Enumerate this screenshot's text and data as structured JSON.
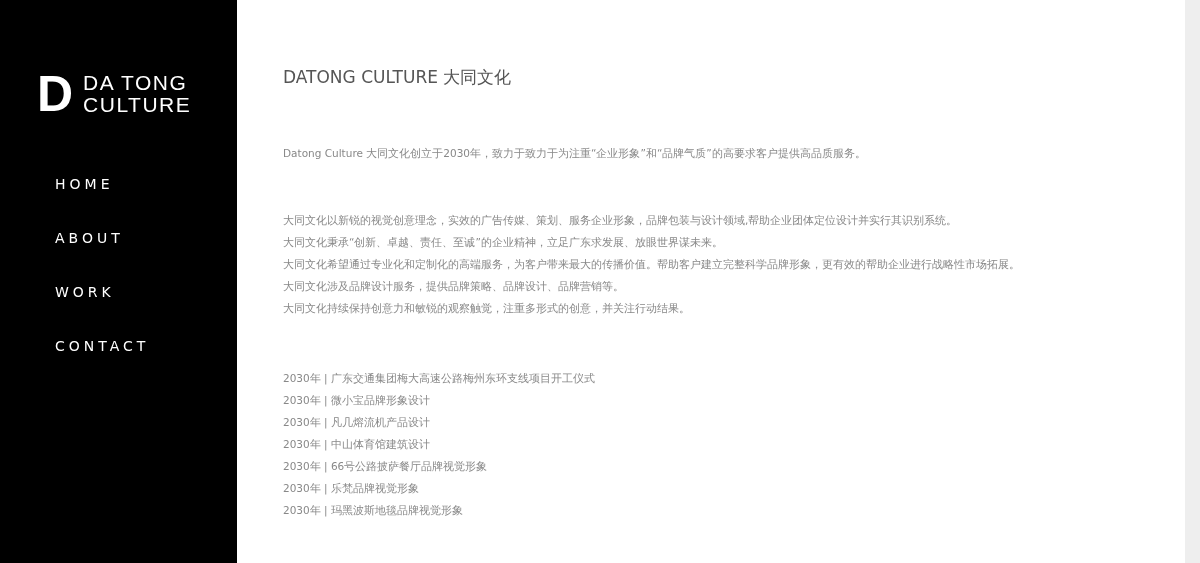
{
  "logo": {
    "mark": "D",
    "lines": [
      "DA TONG",
      "CULTURE"
    ]
  },
  "nav": [
    "HOME",
    "ABOUT",
    "WORK",
    "CONTACT"
  ],
  "title": "DATONG CULTURE 大同文化",
  "intro": "Datong Culture 大同文化创立于2030年，致力于致力于为注重“企业形象”和“品牌气质”的高要求客户提供高品质服务。",
  "about": [
    "大同文化以新锐的视觉创意理念，实效的广告传媒、策划、服务企业形象，品牌包装与设计领域,帮助企业团体定位设计并实行其识别系统。",
    "大同文化秉承“创新、卓越、责任、至诚”的企业精神，立足广东求发展、放眼世界谋未来。",
    "大同文化希望通过专业化和定制化的高端服务，为客户带来最大的传播价值。帮助客户建立完整科学品牌形象，更有效的帮助企业进行战略性市场拓展。",
    "大同文化涉及品牌设计服务，提供品牌策略、品牌设计、品牌营销等。",
    "大同文化持续保持创意力和敏锐的观察触觉，注重多形式的创意，并关注行动结果。"
  ],
  "works": [
    "2030年 | 广东交通集团梅大高速公路梅州东环支线项目开工仪式",
    "2030年 | 微小宝品牌形象设计",
    "2030年 | 凡几熔流机产品设计",
    "2030年 | 中山体育馆建筑设计",
    "2030年 | 66号公路披萨餐厅品牌视觉形象",
    "2030年 | 乐梵品牌视觉形象",
    "2030年 | 玛黑波斯地毯品牌视觉形象"
  ]
}
